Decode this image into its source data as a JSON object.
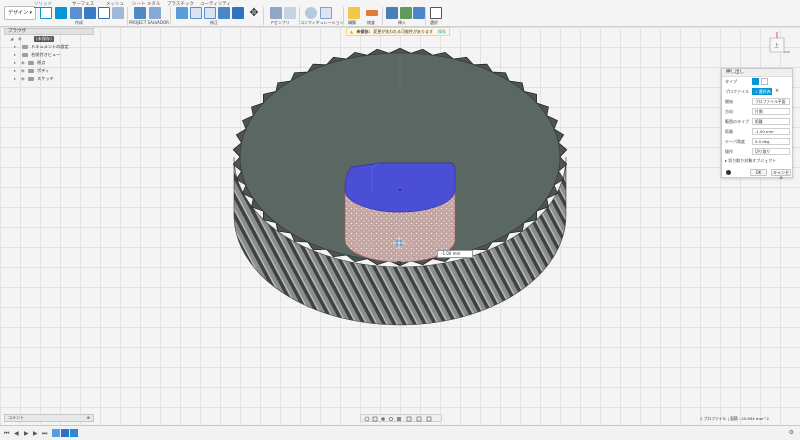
{
  "toolbar": {
    "workspace": "デザイン",
    "tabs": [
      "ソリッド",
      "サーフェス",
      "メッシュ",
      "シート メタル",
      "プラスチック",
      "ユーティリティ"
    ],
    "groups": [
      "作成",
      "PROJECT SALVADOR",
      "修正",
      "アセンブリ",
      "コンフィギュレーション",
      "構築",
      "検査",
      "挿入",
      "選択"
    ]
  },
  "warning": {
    "title": "未保存:",
    "message": "変更が失われる可能性があります",
    "action": "保存"
  },
  "browser": {
    "header": "ブラウザ",
    "root": "(未保存)",
    "items": [
      "ドキュメントの設定",
      "名前付きビュー",
      "原点",
      "ボディ",
      "スケッチ"
    ]
  },
  "viewcube": {
    "face": "上"
  },
  "dialog": {
    "title": "押し出し",
    "rows": [
      {
        "label": "タイプ",
        "value": ""
      },
      {
        "label": "プロファイル",
        "value": "1 選択済み"
      },
      {
        "label": "開始",
        "value": "プロファイル平面"
      },
      {
        "label": "方向",
        "value": "片側"
      },
      {
        "label": "範囲のタイプ",
        "value": "距離"
      },
      {
        "label": "距離",
        "value": "-1.00 mm"
      },
      {
        "label": "テーパ角度",
        "value": "0.0 deg"
      },
      {
        "label": "操作",
        "value": "切り取り"
      }
    ],
    "expander": "切り取り対象オブジェクト",
    "ok": "OK",
    "cancel": "キャンセル"
  },
  "canvas": {
    "dimension": "-1.00 mm"
  },
  "bottom": {
    "comments": "コメント",
    "status": "1 プロファイル | 面積 : 25.894 mm^2"
  },
  "colors": {
    "accent": "#0696d7",
    "face_top": "#5b6762",
    "gear_side": "#7e8482",
    "selection": "#4a4fd6"
  }
}
